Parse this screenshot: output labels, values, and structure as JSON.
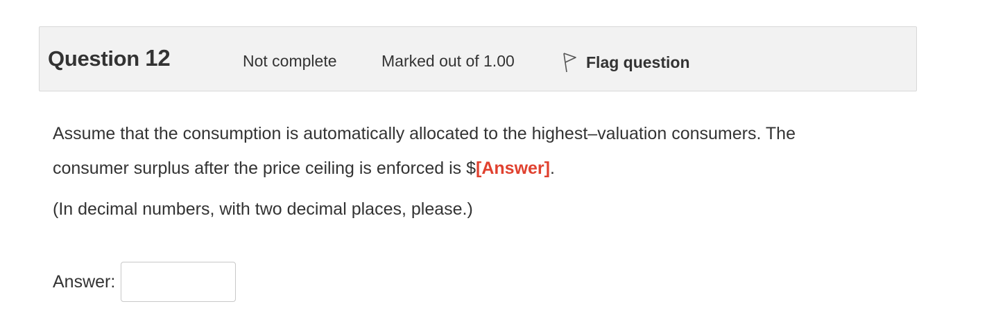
{
  "question": {
    "title_word": "Question",
    "number": "12",
    "state": "Not complete",
    "grade": "Marked out of 1.00",
    "flag_label": "Flag question",
    "flag_icon": "flag-icon"
  },
  "content": {
    "text_before": "Assume that the consumption is automatically allocated to the highest–valuation consumers. The consumer surplus after the price ceiling is enforced is $",
    "answer_token": "[Answer]",
    "text_after": ".",
    "note": "(In decimal numbers, with two decimal places, please.)"
  },
  "answer": {
    "label": "Answer:",
    "value": ""
  },
  "colors": {
    "header_bg": "#f2f2f2",
    "header_border": "#d8d8d8",
    "answer_token": "#e0412f",
    "text": "#333333"
  }
}
